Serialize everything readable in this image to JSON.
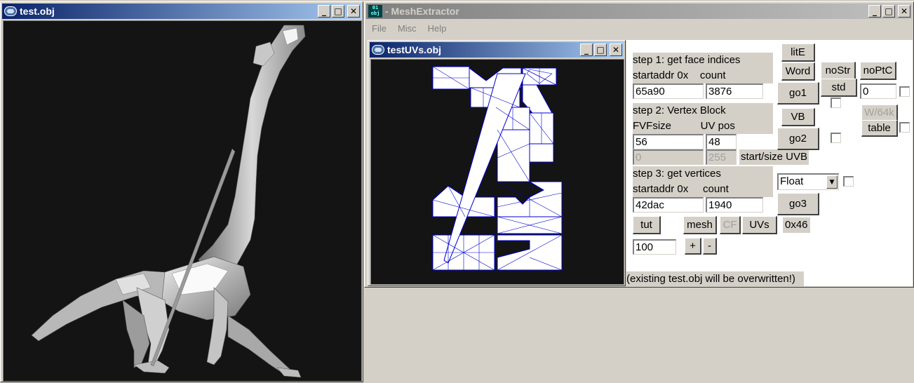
{
  "windows": {
    "obj_viewer": {
      "title": "test.obj"
    },
    "mesh_extractor": {
      "title": "- MeshExtractor"
    },
    "uv_viewer": {
      "title": "testUVs.obj"
    }
  },
  "menu": {
    "file": "File",
    "misc": "Misc",
    "help": "Help"
  },
  "step1": {
    "header": "step 1: get face indices",
    "sub": "startaddr 0x    count",
    "startaddr": "65a90",
    "count": "3876"
  },
  "step2": {
    "header": "step 2: Vertex Block",
    "sub": "FVFsize          UV pos",
    "fvfsize": "56",
    "uvpos": "48",
    "uvb_start": "0",
    "uvb_size": "255",
    "uvb_label": "start/size UVB"
  },
  "step3": {
    "header": "step 3: get vertices",
    "sub": "startaddr 0x     count",
    "startaddr": "42dac",
    "count": "1940"
  },
  "buttons": {
    "lite": "litE",
    "word": "Word",
    "nostr": "noStr",
    "noptc": "noPtC",
    "go1": "go1",
    "std": "std",
    "vb": "VB",
    "w64k": "W/64k",
    "go2": "go2",
    "table": "table",
    "go3": "go3",
    "tut": "tut",
    "mesh": "mesh",
    "cf": "CF",
    "uvs": "UVs",
    "plus": "+",
    "minus": "-"
  },
  "fields": {
    "offset_value": "0",
    "scale_value": "100"
  },
  "float_select": {
    "selected": "Float"
  },
  "hex_label": "0x46",
  "footer_note": "(existing test.obj will be overwritten!)",
  "icons": {
    "window": "window-icon",
    "app": "app-icon"
  }
}
